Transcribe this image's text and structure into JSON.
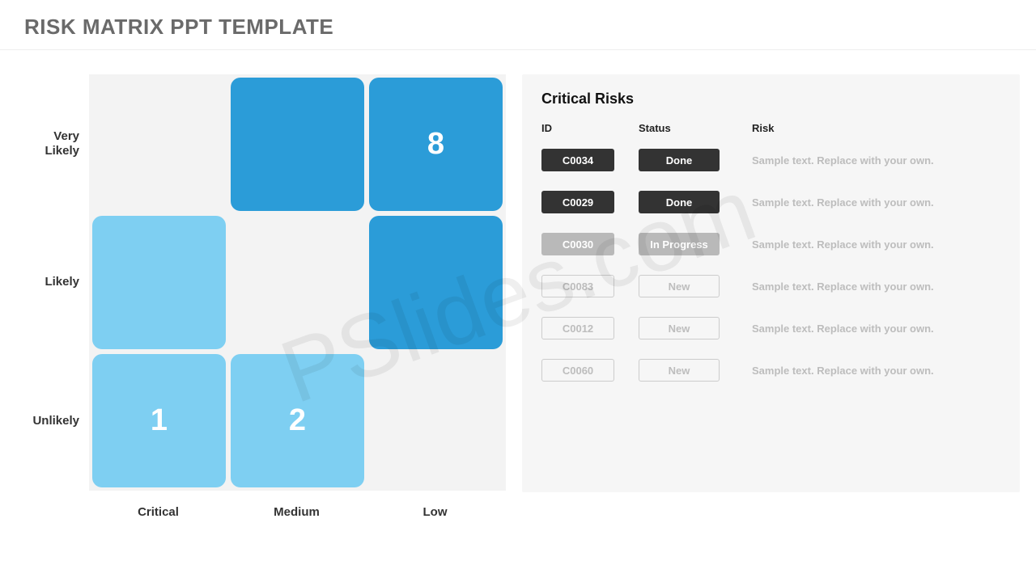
{
  "title": "RISK MATRIX PPT TEMPLATE",
  "watermark": "PSlides.com",
  "matrix": {
    "yLabels": [
      "Very Likely",
      "Likely",
      "Unlikely"
    ],
    "xLabels": [
      "Critical",
      "Medium",
      "Low"
    ],
    "cells": [
      {
        "variant": "empty",
        "value": ""
      },
      {
        "variant": "dark",
        "value": ""
      },
      {
        "variant": "dark",
        "value": "8"
      },
      {
        "variant": "light",
        "value": ""
      },
      {
        "variant": "empty",
        "value": ""
      },
      {
        "variant": "dark",
        "value": ""
      },
      {
        "variant": "light",
        "value": "1"
      },
      {
        "variant": "light",
        "value": "2"
      },
      {
        "variant": "empty",
        "value": ""
      }
    ]
  },
  "risks": {
    "title": "Critical  Risks",
    "headers": {
      "id": "ID",
      "status": "Status",
      "risk": "Risk"
    },
    "rows": [
      {
        "id": "C0034",
        "status": "Done",
        "variant": "dark",
        "risk": "Sample text. Replace with your own."
      },
      {
        "id": "C0029",
        "status": "Done",
        "variant": "dark",
        "risk": "Sample text. Replace with your own."
      },
      {
        "id": "C0030",
        "status": "In Progress",
        "variant": "grey",
        "risk": "Sample text. Replace with your own."
      },
      {
        "id": "C0083",
        "status": "New",
        "variant": "outline",
        "risk": "Sample text. Replace with your own."
      },
      {
        "id": "C0012",
        "status": "New",
        "variant": "outline",
        "risk": "Sample text. Replace with your own."
      },
      {
        "id": "C0060",
        "status": "New",
        "variant": "outline",
        "risk": "Sample text. Replace with your own."
      }
    ]
  }
}
